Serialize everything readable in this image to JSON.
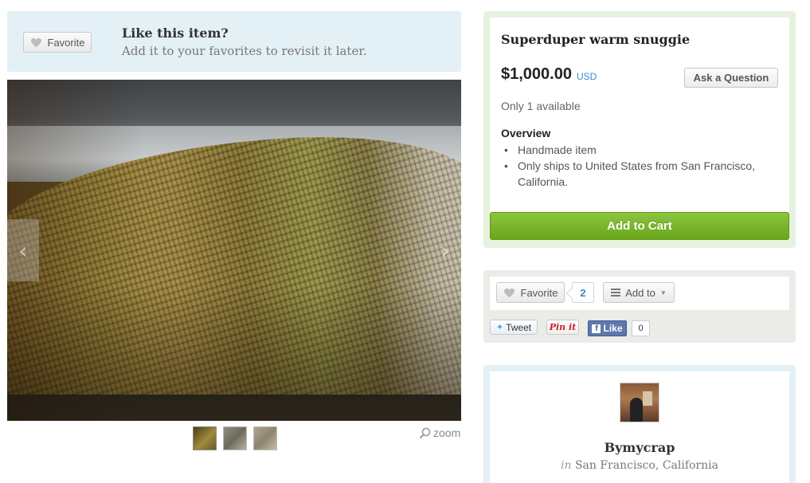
{
  "favorite_banner": {
    "button_label": "Favorite",
    "title": "Like this item?",
    "subtitle": "Add it to your favorites to revisit it later."
  },
  "gallery": {
    "prev_arrow": "‹",
    "next_arrow": "›",
    "zoom_label": "zoom",
    "zoom_icon": "magnifier-icon",
    "thumbnail_count": 3
  },
  "listing": {
    "title": "Superduper warm snuggie",
    "price": "$1,000.00",
    "currency": "USD",
    "ask_button": "Ask a Question",
    "availability": "Only 1 available",
    "overview_title": "Overview",
    "overview_items": [
      "Handmade item",
      "Only ships to United States from San Francisco, California."
    ],
    "add_to_cart": "Add to Cart"
  },
  "social": {
    "favorite_label": "Favorite",
    "favorite_count": "2",
    "add_to_label": "Add to",
    "tweet_label": "Tweet",
    "pin_label": "Pin it",
    "like_label": "Like",
    "like_count": "0"
  },
  "shop": {
    "name": "Bymycrap",
    "location_prefix": "in",
    "location": "San Francisco, California"
  },
  "colors": {
    "accent_blue": "#3a89c9",
    "cart_green": "#7ab82e",
    "banner_blue": "#e3f0f6",
    "buy_green": "#e6f2de"
  }
}
